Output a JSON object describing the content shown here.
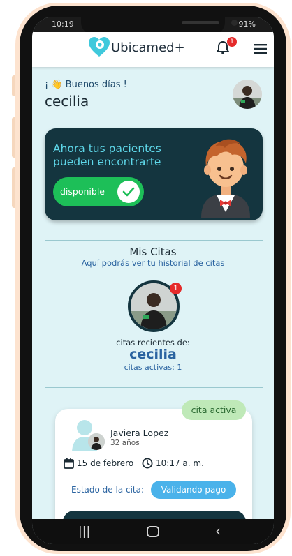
{
  "status_bar": {
    "time": "10:19",
    "battery": "91%"
  },
  "app": {
    "name": "Ubicamed+",
    "notification_count": "1"
  },
  "greeting": {
    "text": "¡ 👋 Buenos días !",
    "user": "cecilia"
  },
  "banner": {
    "text": "Ahora tus pacientes pueden encontrarte",
    "toggle_label": "disponible",
    "toggle_on": true
  },
  "citas": {
    "title": "Mis Citas",
    "subtitle": "Aquí podrás ver tu historial de citas",
    "avatar_badge": "1",
    "recent_label": "citas recientes de:",
    "recent_name": "cecilia",
    "active_count": "citas activas: 1"
  },
  "appointment": {
    "status_chip": "cita activa",
    "patient_name": "Javiera Lopez",
    "patient_age": "32 años",
    "date": "15 de febrero",
    "time": "10:17 a. m.",
    "estado_label": "Estado de la cita:",
    "estado_value": "Validando pago"
  },
  "colors": {
    "accent": "#5fd8ea",
    "dark_panel": "#14353f",
    "green": "#1dbf58",
    "blue": "#4ab2ea",
    "badge": "#e52b2b"
  },
  "icons": [
    "heart-location-logo-icon",
    "bell-icon",
    "hamburger-menu-icon",
    "check-icon",
    "calendar-icon",
    "clock-icon",
    "user-icon"
  ]
}
